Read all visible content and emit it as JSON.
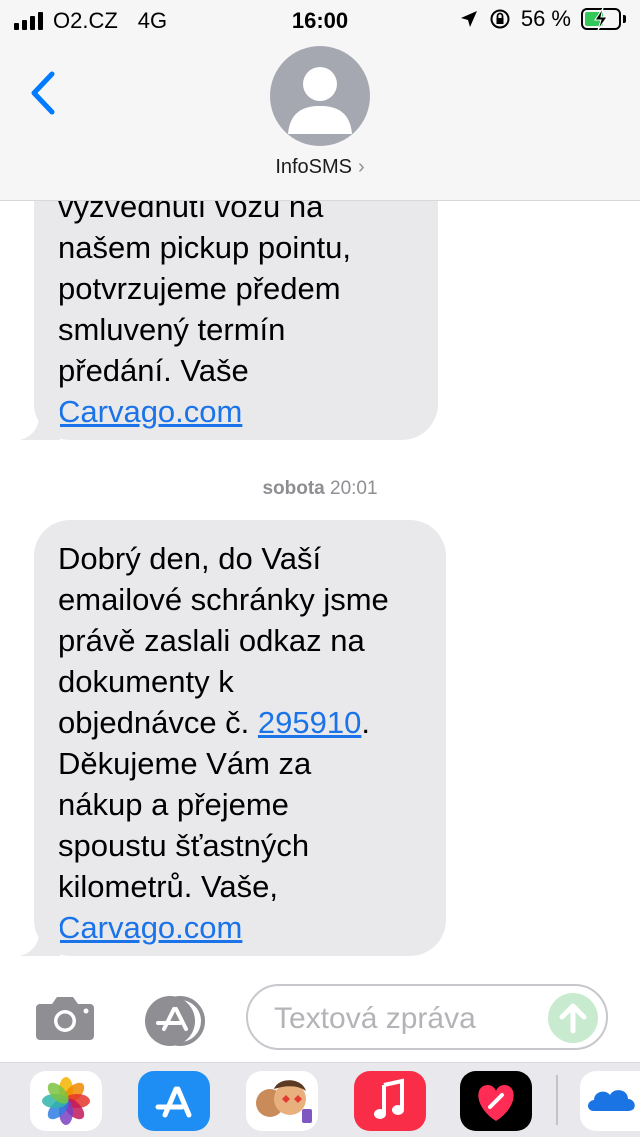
{
  "status_bar": {
    "carrier": "O2.CZ",
    "network": "4G",
    "time": "16:00",
    "battery_percent": "56 %",
    "battery_level": 0.56
  },
  "nav": {
    "contact_name": "InfoSMS",
    "chevron": "›"
  },
  "messages": [
    {
      "lines": [
        "vyzvednutí vozu na",
        "našem pickup pointu,",
        "potvrzujeme předem",
        "smluvený termín",
        "předání. Vaše"
      ],
      "link": "Carvago.com"
    },
    {
      "lines_before": [
        "Dobrý den, do Vaší",
        "emailové schránky jsme",
        "právě zaslali odkaz na",
        "dokumenty k"
      ],
      "order_prefix": "objednávce č. ",
      "order_number": "295910",
      "order_suffix": ".",
      "lines_after": [
        "Děkujeme Vám za",
        "nákup a přejeme",
        "spoustu šťastných",
        "kilometrů. Vaše,"
      ],
      "link": "Carvago.com"
    }
  ],
  "timestamp": {
    "day": "sobota",
    "time": " 20:01"
  },
  "composer": {
    "placeholder": "Textová zpráva"
  },
  "dock": {
    "apps": [
      {
        "name": "photos-icon"
      },
      {
        "name": "app-store-icon"
      },
      {
        "name": "memoji-icon"
      },
      {
        "name": "music-icon"
      },
      {
        "name": "heart-app-icon"
      },
      {
        "name": "onedrive-icon"
      }
    ]
  },
  "colors": {
    "bubble": "#e9e9eb",
    "link": "#1a73e8",
    "send_disabled": "#c8ebcf",
    "ios_blue": "#007aff"
  }
}
